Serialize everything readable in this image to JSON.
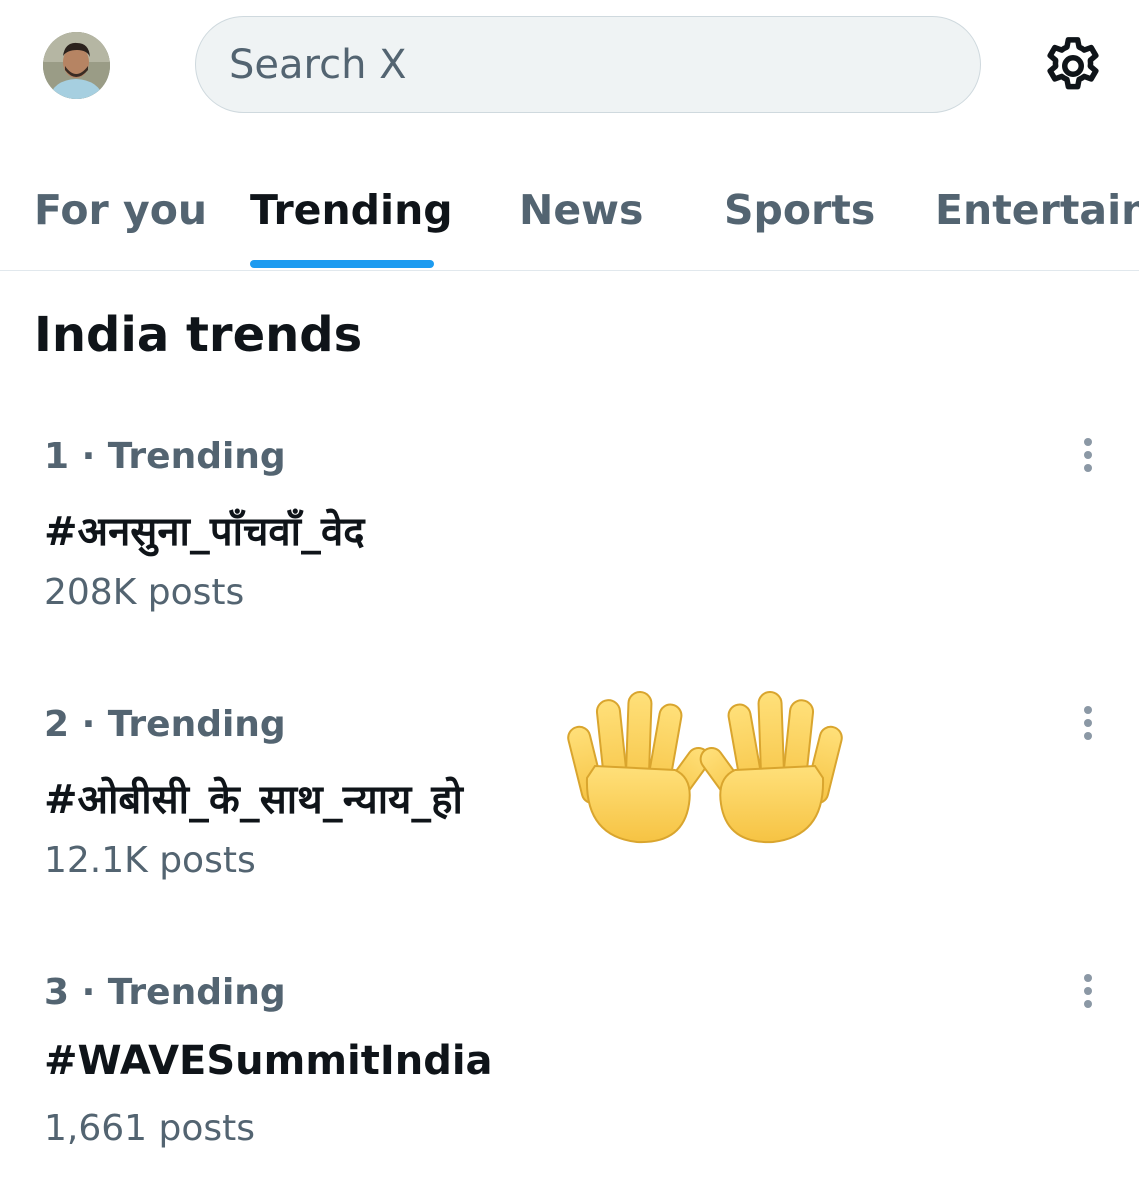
{
  "header": {
    "avatar_alt": "Profile avatar",
    "search_placeholder": "Search X"
  },
  "tabs": [
    {
      "label": "For you",
      "active": false
    },
    {
      "label": "Trending",
      "active": true
    },
    {
      "label": "News",
      "active": false
    },
    {
      "label": "Sports",
      "active": false
    },
    {
      "label": "Entertainment",
      "active": false
    }
  ],
  "section": {
    "title": "India trends"
  },
  "trends": [
    {
      "meta": "1 · Trending",
      "name": "#अनसुना_पाँचवाँ_वेद",
      "posts": "208K posts"
    },
    {
      "meta": "2 · Trending",
      "name": "#ओबीसी_के_साथ_न्याय_हो",
      "posts": "12.1K posts"
    },
    {
      "meta": "3 · Trending",
      "name": "#WAVESummitIndia",
      "posts": "1,661 posts"
    }
  ],
  "colors": {
    "accent": "#1d9bf0",
    "text_primary": "#0f1419",
    "text_secondary": "#536471",
    "search_bg": "#eff3f4",
    "divider": "#e1e8ed"
  },
  "icons": {
    "settings": "gear-icon",
    "more": "more-vertical-icon",
    "decoration": "raised-hands-emoji"
  }
}
